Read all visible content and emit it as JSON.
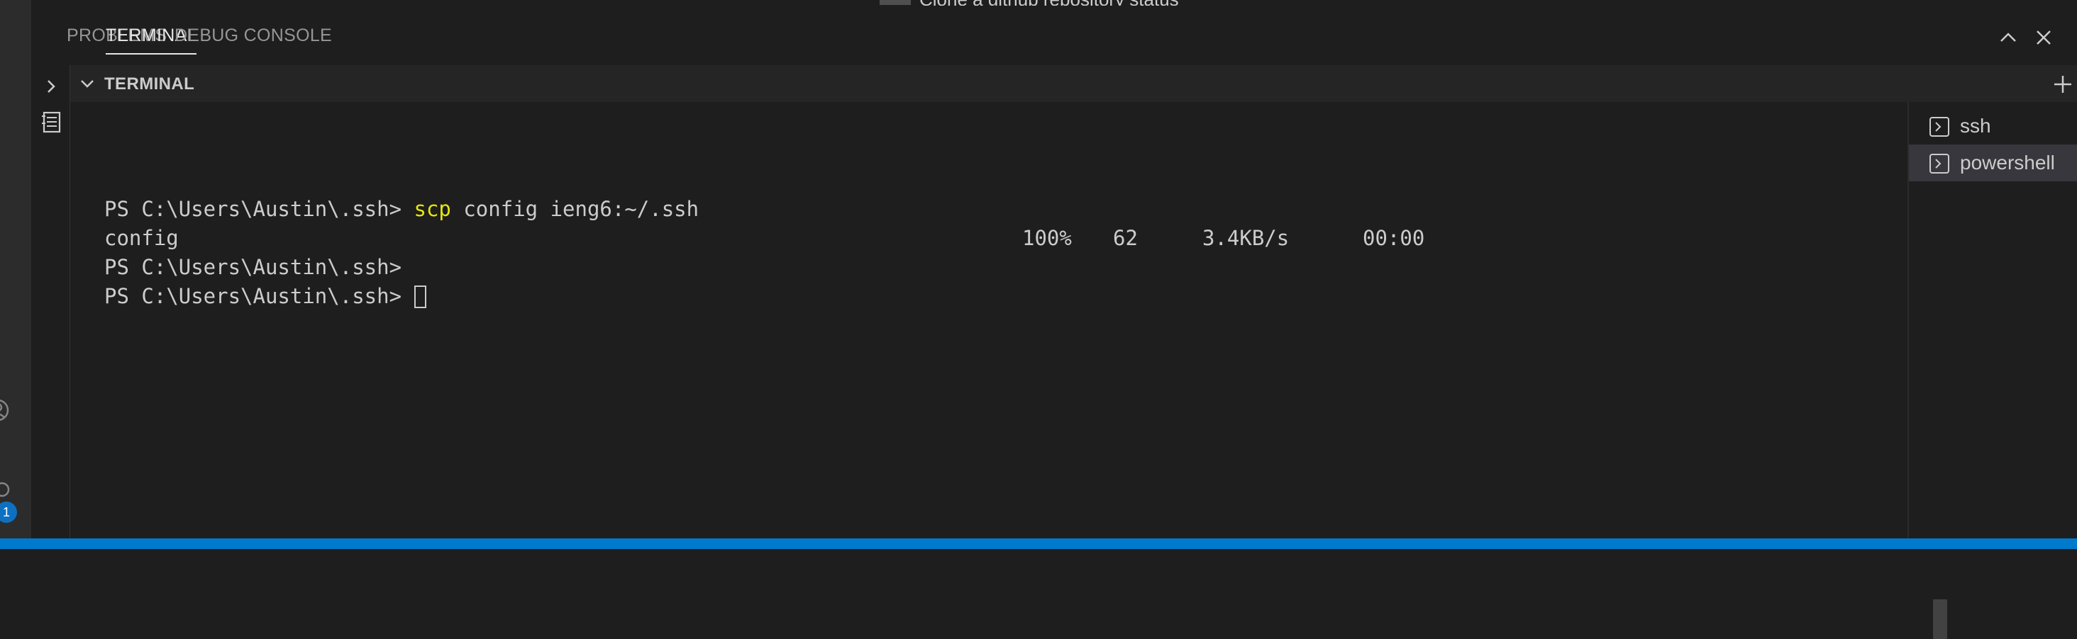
{
  "editor": {
    "overflow_text": "Clone a github repository status"
  },
  "panel": {
    "tabs": [
      {
        "label": "PROBLEMS"
      },
      {
        "label": "TERMINAL"
      },
      {
        "label": "DEBUG CONSOLE"
      }
    ],
    "active_tab": "TERMINAL"
  },
  "terminal": {
    "section_title": "TERMINAL",
    "lines": [
      {
        "prompt": "PS C:\\Users\\Austin\\.ssh> ",
        "command": "scp",
        "args": " config ieng6:~/.ssh"
      },
      {
        "file": "config",
        "percent": "100%",
        "size": "62",
        "rate": "3.4KB/s",
        "eta": "00:00"
      },
      {
        "prompt": "PS C:\\Users\\Austin\\.ssh>"
      },
      {
        "prompt": "PS C:\\Users\\Austin\\.ssh> "
      }
    ],
    "instances": [
      {
        "label": "ssh",
        "icon": "terminal-icon"
      },
      {
        "label": "powershell",
        "icon": "terminal-icon"
      }
    ],
    "selected_instance": "powershell"
  },
  "activity_bar": {
    "badge_count": "1"
  },
  "colors": {
    "status_bar": "#007acc",
    "command": "#e5e510",
    "background": "#1e1e1e"
  }
}
